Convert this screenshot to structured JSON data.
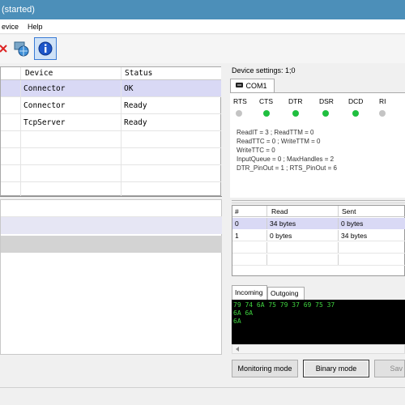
{
  "window": {
    "title": "started)"
  },
  "menu": {
    "device": "evice",
    "help": "Help"
  },
  "devices_table": {
    "headers": [
      "Device",
      "Status"
    ],
    "rows": [
      {
        "device": "Connector",
        "status": "OK"
      },
      {
        "device": "Connector",
        "status": "Ready"
      },
      {
        "device": "TcpServer",
        "status": "Ready"
      }
    ]
  },
  "device_panel": {
    "settings_label": "Device settings: 1;0",
    "tab_label": "COM1",
    "signals": [
      "RTS",
      "CTS",
      "DTR",
      "DSR",
      "DCD",
      "RI"
    ],
    "signal_states": [
      "off",
      "on",
      "on",
      "on",
      "on",
      "off"
    ],
    "info_lines": [
      "ReadIT = 3 ; ReadTTM = 0",
      "ReadTTC = 0 ; WriteTTM = 0",
      "WriteTTC = 0",
      "InputQueue = 0 ; MaxHandles = 2",
      "DTR_PinOut = 1 ; RTS_PinOut = 6"
    ]
  },
  "ports_table": {
    "headers": [
      "#",
      "Read",
      "Sent"
    ],
    "rows": [
      {
        "num": "0",
        "read": "34 bytes",
        "sent": "0 bytes"
      },
      {
        "num": "1",
        "read": "0 bytes",
        "sent": "34 bytes"
      }
    ]
  },
  "io_tabs": {
    "incoming": "Incoming",
    "outgoing": "Outgoing"
  },
  "console": {
    "lines": [
      "79 74 6A 75 79 37 69 75 37",
      "6A 6A",
      "6A"
    ]
  },
  "buttons": {
    "monitoring": "Monitoring mode",
    "binary": "Binary mode",
    "save": "Sav"
  },
  "colors": {
    "titlebar": "#4c8fb9",
    "led_on": "#1fbf3f",
    "led_off": "#c4c4c4",
    "selection": "#d9d9f5",
    "console_text": "#3fd33f"
  }
}
